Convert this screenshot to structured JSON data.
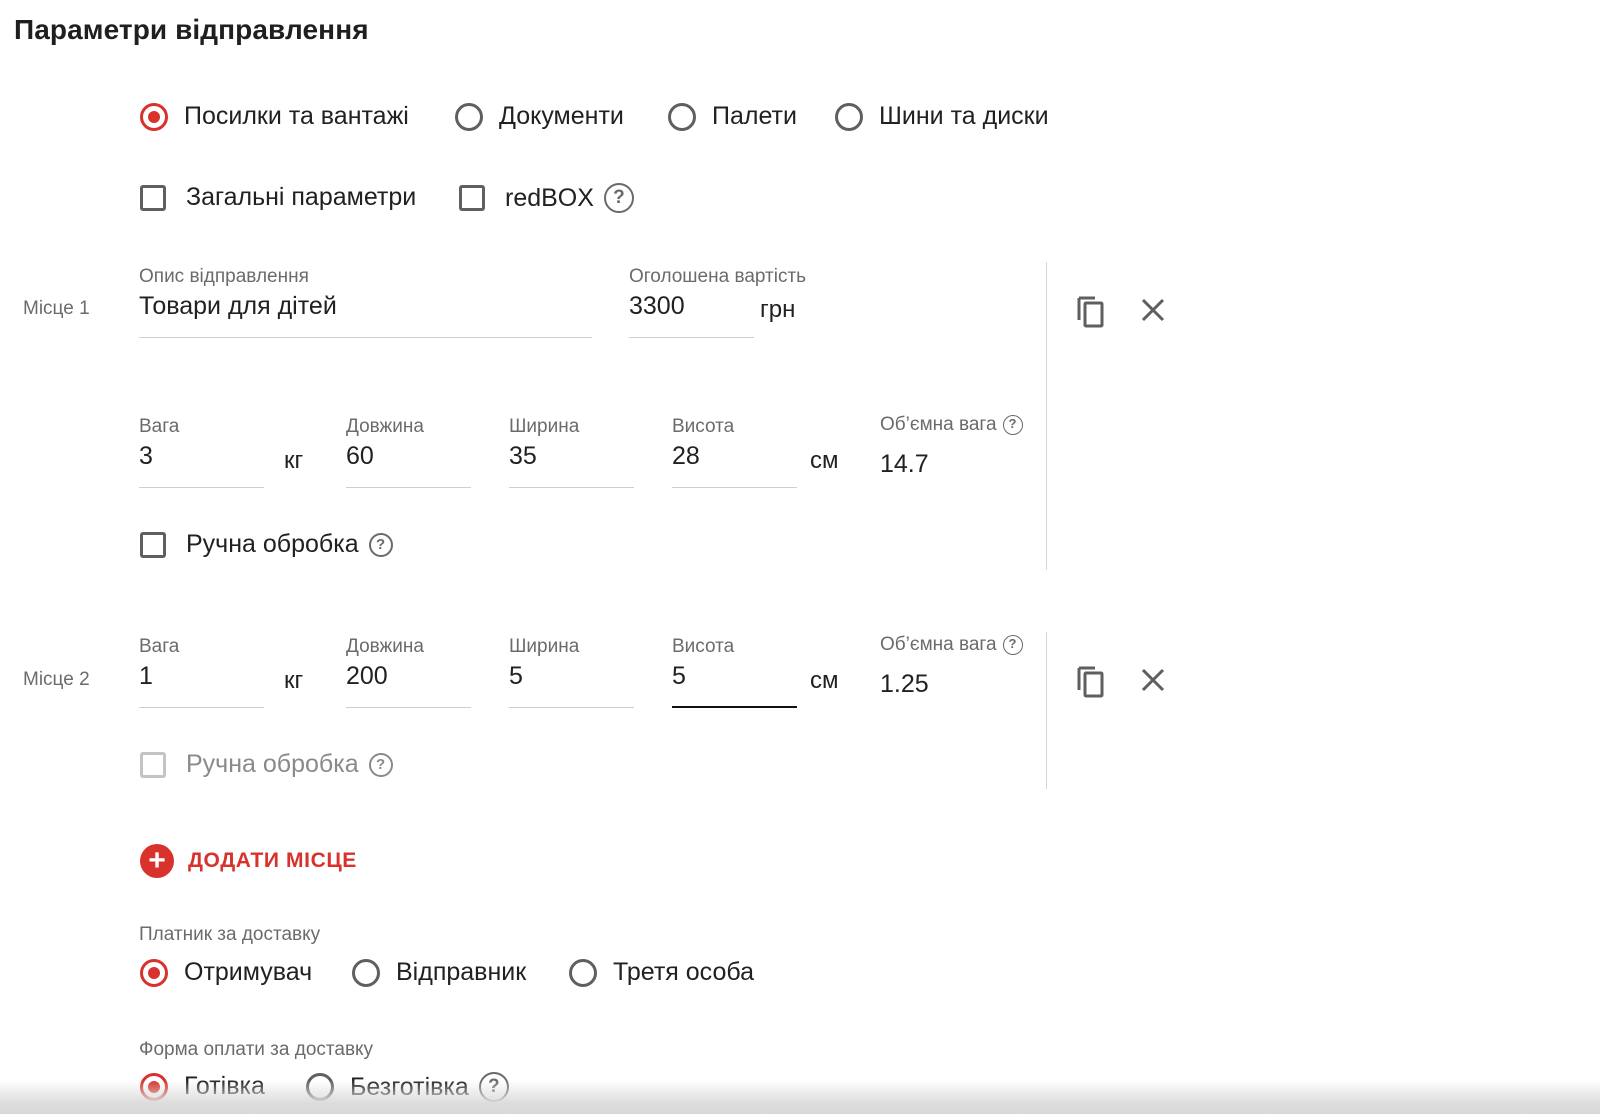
{
  "title": "Параметри відправлення",
  "shipment_types": [
    {
      "label": "Посилки та вантажі",
      "checked": true
    },
    {
      "label": "Документи",
      "checked": false
    },
    {
      "label": "Палети",
      "checked": false
    },
    {
      "label": "Шини та диски",
      "checked": false
    }
  ],
  "options": {
    "general_params": "Загальні параметри",
    "redbox": "redBOX",
    "help_glyph": "?"
  },
  "places": [
    {
      "label": "Місце 1",
      "description_label": "Опис відправлення",
      "description_value": "Товари для дітей",
      "declared_label": "Оголошена вартість",
      "declared_value": "3300",
      "currency": "грн",
      "weight_label": "Вага",
      "weight_value": "3",
      "weight_unit": "кг",
      "length_label": "Довжина",
      "length_value": "60",
      "width_label": "Ширина",
      "width_value": "35",
      "height_label": "Висота",
      "height_value": "28",
      "dim_unit": "см",
      "volume_label": "Об’ємна вага",
      "volume_value": "14.7",
      "manual_label": "Ручна обробка"
    },
    {
      "label": "Місце 2",
      "weight_label": "Вага",
      "weight_value": "1",
      "weight_unit": "кг",
      "length_label": "Довжина",
      "length_value": "200",
      "width_label": "Ширина",
      "width_value": "5",
      "height_label": "Висота",
      "height_value": "5",
      "dim_unit": "см",
      "volume_label": "Об’ємна вага",
      "volume_value": "1.25",
      "manual_label": "Ручна обробка"
    }
  ],
  "add_place": {
    "plus": "+",
    "label": "ДОДАТИ МІСЦЕ"
  },
  "payer": {
    "label": "Платник за доставку",
    "options": [
      {
        "label": "Отримувач",
        "checked": true
      },
      {
        "label": "Відправник",
        "checked": false
      },
      {
        "label": "Третя особа",
        "checked": false
      }
    ]
  },
  "payment_form": {
    "label": "Форма оплати за доставку",
    "options": [
      {
        "label": "Готівка",
        "checked": true
      },
      {
        "label": "Безготівка",
        "checked": false
      }
    ]
  },
  "colors": {
    "accent": "#d8322c",
    "text": "#212121",
    "muted": "#6b6b6b"
  },
  "icons": {
    "copy": "copy-icon",
    "close": "close-icon",
    "help": "help-circle-icon",
    "add": "plus-circle-icon"
  }
}
